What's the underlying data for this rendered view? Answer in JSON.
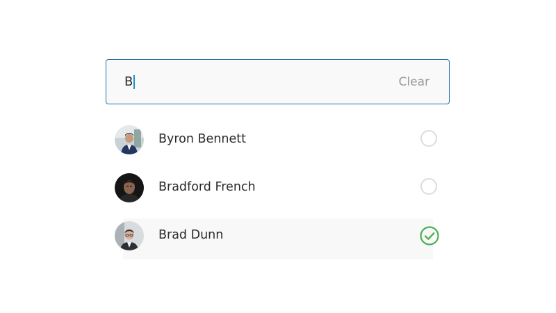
{
  "search": {
    "value": "B",
    "clear_label": "Clear"
  },
  "results": [
    {
      "name": "Byron Bennett",
      "selected": false,
      "avatar_icon": "person-photo-icon"
    },
    {
      "name": "Bradford French",
      "selected": false,
      "avatar_icon": "person-photo-icon"
    },
    {
      "name": "Brad Dunn",
      "selected": true,
      "avatar_icon": "person-photo-icon"
    }
  ],
  "colors": {
    "focus_border": "#1f6fa8",
    "caret": "#1f8fd6",
    "check_green": "#4caf50",
    "radio_border": "#dcdcdc"
  }
}
